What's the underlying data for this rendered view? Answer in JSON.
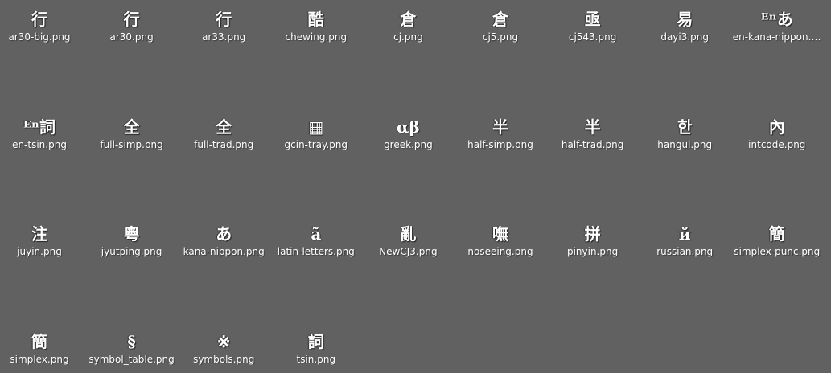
{
  "files": [
    {
      "label": "ar30-big.png",
      "glyph": "行",
      "icon": "ar30-big-icon"
    },
    {
      "label": "ar30.png",
      "glyph": "行",
      "icon": "ar30-icon"
    },
    {
      "label": "ar33.png",
      "glyph": "行",
      "icon": "ar33-icon"
    },
    {
      "label": "chewing.png",
      "glyph": "酷",
      "icon": "chewing-icon"
    },
    {
      "label": "cj.png",
      "glyph": "倉",
      "icon": "cj-icon"
    },
    {
      "label": "cj5.png",
      "glyph": "倉",
      "icon": "cj5-icon"
    },
    {
      "label": "cj543.png",
      "glyph": "亟",
      "icon": "cj543-icon"
    },
    {
      "label": "dayi3.png",
      "glyph": "易",
      "icon": "dayi3-icon"
    },
    {
      "label": "en-kana-nippon.png",
      "glyph": "ᴱⁿあ",
      "icon": "en-kana-nippon-icon"
    },
    {
      "label": "en-tsin.png",
      "glyph": "ᴱⁿ詞",
      "icon": "en-tsin-icon"
    },
    {
      "label": "full-simp.png",
      "glyph": "全",
      "icon": "full-simp-icon"
    },
    {
      "label": "full-trad.png",
      "glyph": "全",
      "icon": "full-trad-icon"
    },
    {
      "label": "gcin-tray.png",
      "glyph": "▦",
      "icon": "gcin-tray-icon"
    },
    {
      "label": "greek.png",
      "glyph": "αβ",
      "icon": "greek-icon"
    },
    {
      "label": "half-simp.png",
      "glyph": "半",
      "icon": "half-simp-icon"
    },
    {
      "label": "half-trad.png",
      "glyph": "半",
      "icon": "half-trad-icon"
    },
    {
      "label": "hangul.png",
      "glyph": "한",
      "icon": "hangul-icon"
    },
    {
      "label": "intcode.png",
      "glyph": "內",
      "icon": "intcode-icon"
    },
    {
      "label": "juyin.png",
      "glyph": "注",
      "icon": "juyin-icon"
    },
    {
      "label": "jyutping.png",
      "glyph": "粵",
      "icon": "jyutping-icon"
    },
    {
      "label": "kana-nippon.png",
      "glyph": "あ",
      "icon": "kana-nippon-icon"
    },
    {
      "label": "latin-letters.png",
      "glyph": "ã",
      "icon": "latin-letters-icon"
    },
    {
      "label": "NewCJ3.png",
      "glyph": "亂",
      "icon": "newcj3-icon"
    },
    {
      "label": "noseeing.png",
      "glyph": "嘸",
      "icon": "noseeing-icon"
    },
    {
      "label": "pinyin.png",
      "glyph": "拼",
      "icon": "pinyin-icon"
    },
    {
      "label": "russian.png",
      "glyph": "й",
      "icon": "russian-icon"
    },
    {
      "label": "simplex-punc.png",
      "glyph": "簡",
      "icon": "simplex-punc-icon"
    },
    {
      "label": "simplex.png",
      "glyph": "簡",
      "icon": "simplex-icon"
    },
    {
      "label": "symbol_table.png",
      "glyph": "§",
      "icon": "symbol-table-icon"
    },
    {
      "label": "symbols.png",
      "glyph": "※",
      "icon": "symbols-icon"
    },
    {
      "label": "tsin.png",
      "glyph": "詞",
      "icon": "tsin-icon"
    }
  ]
}
